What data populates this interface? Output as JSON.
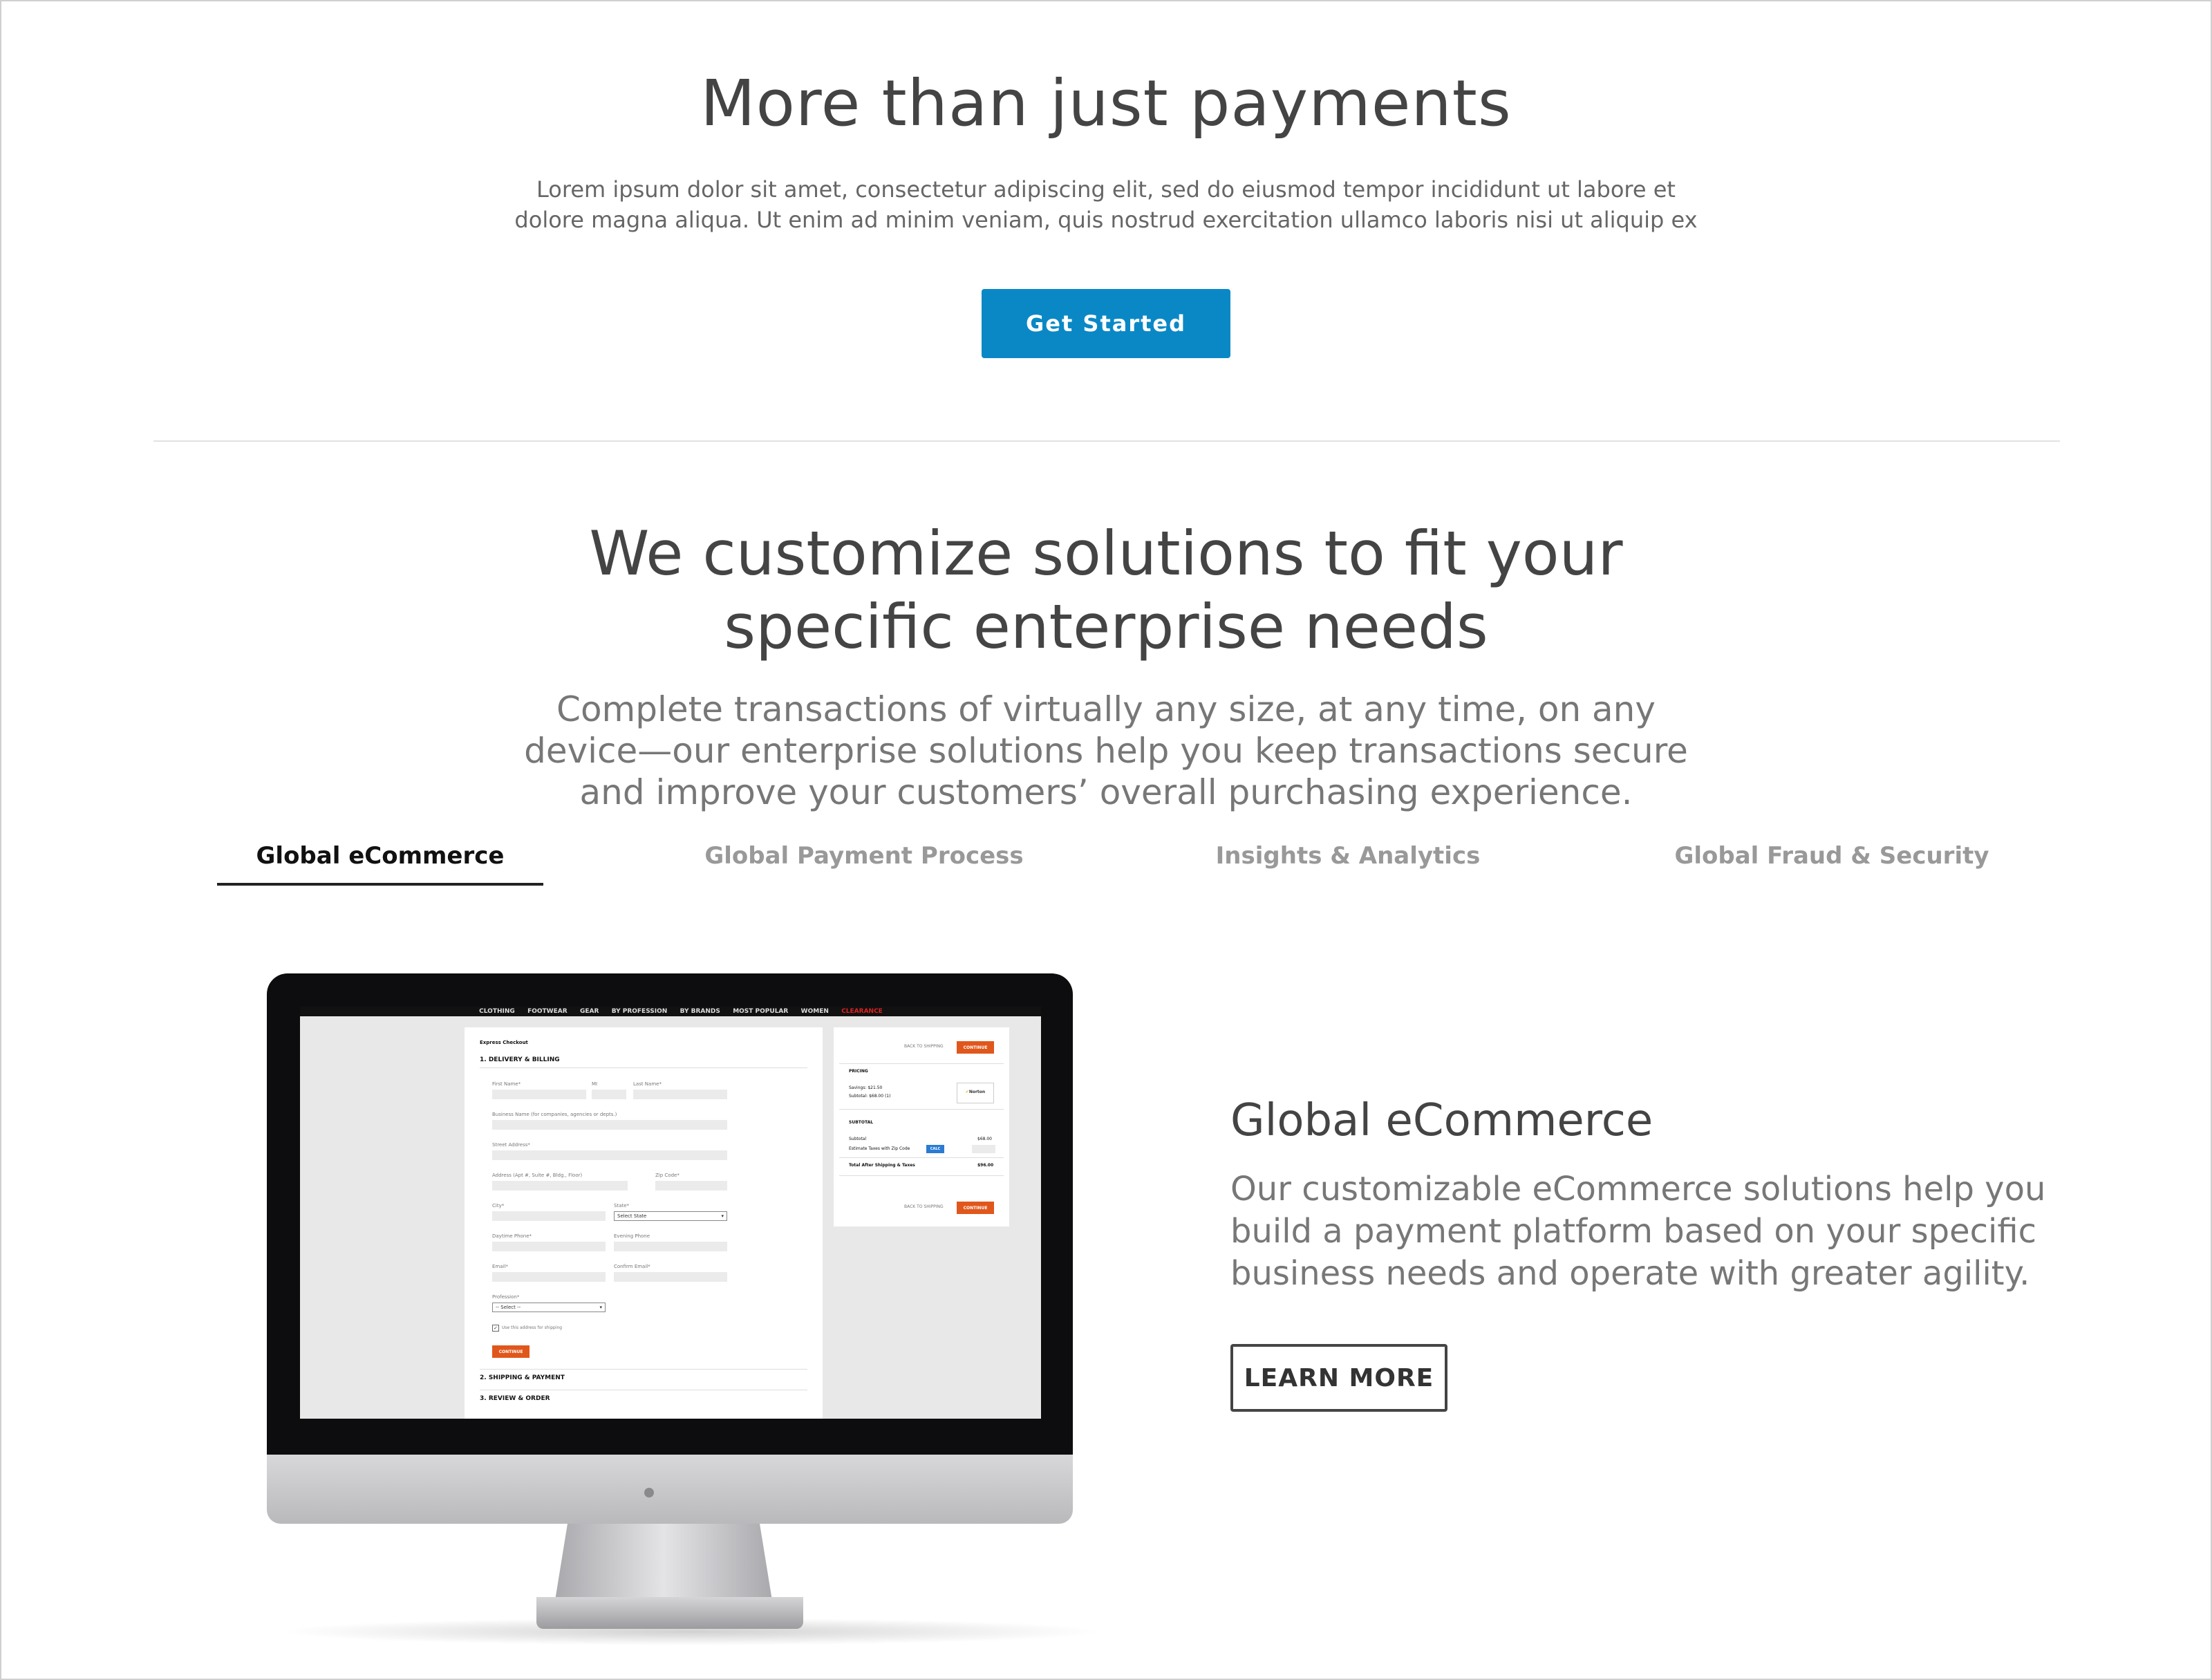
{
  "hero": {
    "title": "More than just payments",
    "text_line1": "Lorem ipsum dolor sit amet, consectetur adipiscing elit, sed do eiusmod tempor incididunt ut labore et",
    "text_line2": "dolore magna aliqua. Ut enim ad minim veniam, quis nostrud exercitation ullamco laboris nisi ut aliquip ex",
    "cta_label": "Get Started"
  },
  "solutions": {
    "title_line1": "We customize solutions to fit your",
    "title_line2": "specific enterprise needs",
    "text_line1": "Complete transactions of virtually any size, at any time, on any",
    "text_line2": "device—our enterprise solutions help you keep transactions secure",
    "text_line3": "and improve your customers’ overall purchasing experience."
  },
  "tabs": [
    {
      "label": "Global eCommerce",
      "active": true
    },
    {
      "label": "Global Payment Process",
      "active": false
    },
    {
      "label": "Insights & Analytics",
      "active": false
    },
    {
      "label": "Global Fraud & Security",
      "active": false
    }
  ],
  "feature": {
    "title": "Global eCommerce",
    "text_line1": "Our customizable eCommerce solutions help you",
    "text_line2": "build a payment platform based on your specific",
    "text_line3": "business needs and operate with greater agility.",
    "button_label": "LEARN MORE"
  },
  "screen": {
    "nav": [
      "CLOTHING",
      "FOOTWEAR",
      "GEAR",
      "BY PROFESSION",
      "BY BRANDS",
      "MOST POPULAR",
      "WOMEN",
      "CLEARANCE"
    ],
    "checkout_title": "Express Checkout",
    "step1": "1. DELIVERY & BILLING",
    "first_name": "First Name*",
    "mi": "MI",
    "last_name": "Last Name*",
    "business_name": "Business Name (for companies, agencies or depts.)",
    "street": "Street Address*",
    "address2": "Address (Apt #, Suite #, Bldg., Floor)",
    "zip": "Zip Code*",
    "city": "City*",
    "state": "State*",
    "state_select": "Select State",
    "day_phone": "Daytime Phone*",
    "eve_phone": "Evening Phone",
    "email": "Email*",
    "confirm_email": "Confirm Email*",
    "profession": "Profession*",
    "profession_select": "-- Select --",
    "use_address": "Use this address for shipping",
    "continue": "CONTINUE",
    "step2": "2. SHIPPING & PAYMENT",
    "step3": "3. REVIEW & ORDER",
    "back_to_shipping": "BACK TO SHIPPING",
    "pricing": "PRICING",
    "savings": "Savings: $21.50",
    "subtotal_count": "Subtotal: $68.00 (1)",
    "subtotal_head": "SUBTOTAL",
    "subtotal_label": "Subtotal",
    "subtotal_value": "$68.00",
    "est_taxes": "Estimate Taxes with Zip Code",
    "calc": "CALC",
    "total_label": "Total After Shipping & Taxes",
    "total_value": "$96.00",
    "norton": "Norton"
  }
}
